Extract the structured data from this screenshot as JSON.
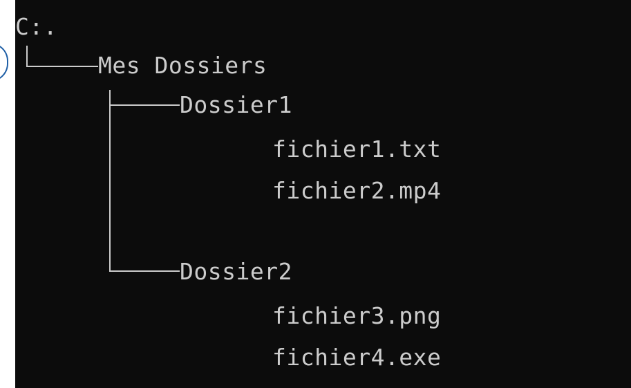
{
  "terminal": {
    "drive": "C:.",
    "root_folder": "Mes Dossiers",
    "folders": [
      {
        "name": "Dossier1",
        "files": [
          "fichier1.txt",
          "fichier2.mp4"
        ]
      },
      {
        "name": "Dossier2",
        "files": [
          "fichier3.png",
          "fichier4.exe"
        ]
      }
    ]
  },
  "colors": {
    "terminal_background": "#0c0c0c",
    "terminal_text": "#cccccc",
    "edge_mark": "#1f5fa6"
  }
}
